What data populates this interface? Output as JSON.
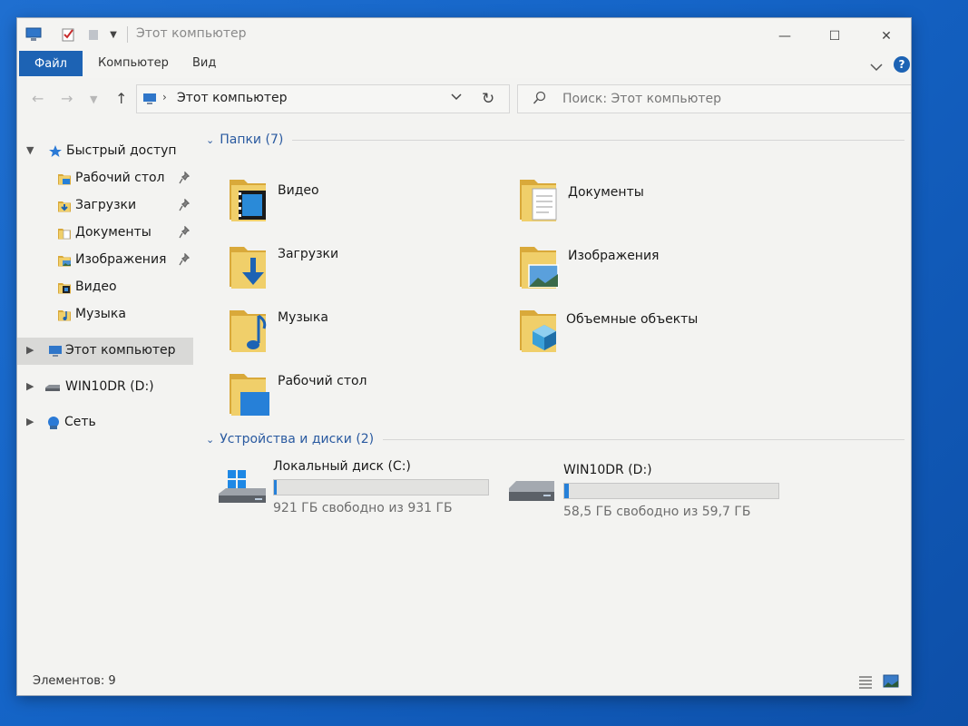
{
  "window": {
    "title": "Этот компьютер",
    "controls": {
      "minimize": "—",
      "maximize": "☐",
      "close": "✕"
    }
  },
  "ribbon": {
    "tabs": [
      {
        "label": "Файл",
        "active": true
      },
      {
        "label": "Компьютер"
      },
      {
        "label": "Вид"
      }
    ],
    "help_label": "?"
  },
  "address": {
    "path": "Этот компьютер",
    "search_placeholder": "Поиск: Этот компьютер"
  },
  "sidebar": {
    "items": [
      {
        "label": "Быстрый доступ",
        "icon": "star-icon",
        "expander": "expanded"
      },
      {
        "label": "Рабочий стол",
        "icon": "desktop-folder-icon",
        "pinned": true
      },
      {
        "label": "Загрузки",
        "icon": "downloads-folder-icon",
        "pinned": true
      },
      {
        "label": "Документы",
        "icon": "documents-folder-icon",
        "pinned": true
      },
      {
        "label": "Изображения",
        "icon": "pictures-folder-icon",
        "pinned": true
      },
      {
        "label": "Видео",
        "icon": "videos-folder-icon"
      },
      {
        "label": "Музыка",
        "icon": "music-folder-icon"
      },
      {
        "label": "Этот компьютер",
        "icon": "computer-icon",
        "expander": "collapsed",
        "selected": true
      },
      {
        "label": "WIN10DR (D:)",
        "icon": "usb-drive-icon",
        "expander": "collapsed"
      },
      {
        "label": "Сеть",
        "icon": "network-icon",
        "expander": "collapsed"
      }
    ]
  },
  "folders": {
    "heading": "Папки (7)",
    "items": [
      {
        "label": "Видео",
        "icon": "videos-folder-icon"
      },
      {
        "label": "Документы",
        "icon": "documents-folder-icon"
      },
      {
        "label": "Загрузки",
        "icon": "downloads-folder-icon"
      },
      {
        "label": "Изображения",
        "icon": "pictures-folder-icon"
      },
      {
        "label": "Музыка",
        "icon": "music-folder-icon"
      },
      {
        "label": "Объемные объекты",
        "icon": "3d-objects-folder-icon"
      },
      {
        "label": "Рабочий стол",
        "icon": "desktop-folder-icon"
      }
    ]
  },
  "devices": {
    "heading": "Устройства и диски (2)",
    "items": [
      {
        "name": "Локальный диск (C:)",
        "free_text": "921 ГБ свободно из 931 ГБ",
        "used_fraction": 0.0107,
        "icon": "windows-drive-icon"
      },
      {
        "name": "WIN10DR (D:)",
        "free_text": "58,5 ГБ свободно из 59,7 ГБ",
        "used_fraction": 0.0201,
        "icon": "removable-drive-icon"
      }
    ]
  },
  "status": {
    "items_count": "Элементов: 9"
  },
  "colors": {
    "accent": "#1d63b4",
    "folder": "#e8c25a",
    "drive_fill": "#2680d8",
    "group_heading": "#2a5aa0"
  }
}
